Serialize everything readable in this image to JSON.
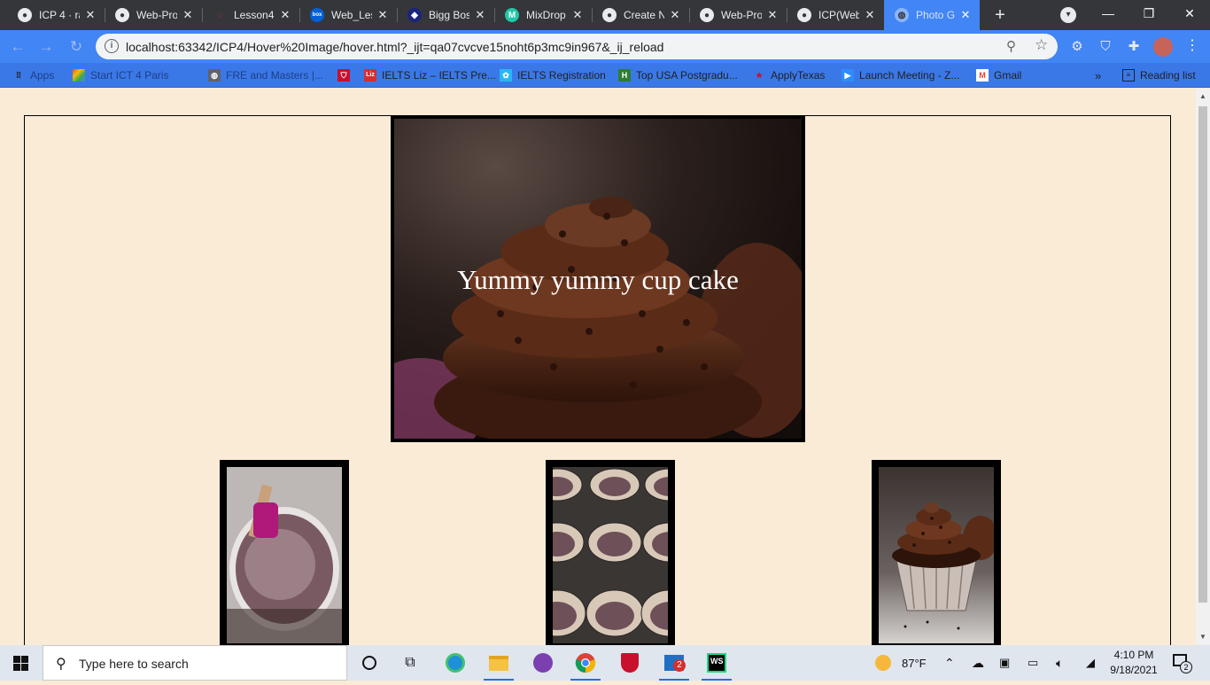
{
  "browser": {
    "tabs": [
      {
        "title": "ICP 4 · ra",
        "icon": "github-icon"
      },
      {
        "title": "Web-Pro",
        "icon": "github-icon"
      },
      {
        "title": "Lesson4",
        "icon": "loading-icon"
      },
      {
        "title": "Web_Les",
        "icon": "box-icon"
      },
      {
        "title": "Bigg Bos",
        "icon": "site-icon"
      },
      {
        "title": "MixDrop",
        "icon": "mixdrop-icon"
      },
      {
        "title": "Create N",
        "icon": "github-icon"
      },
      {
        "title": "Web-Pro",
        "icon": "github-icon"
      },
      {
        "title": "ICP(Web",
        "icon": "github-icon"
      },
      {
        "title": "Photo G",
        "icon": "globe-icon",
        "active": true
      }
    ],
    "url": "localhost:63342/ICP4/Hover%20Image/hover.html?_ijt=qa07cvcve15noht6p3mc9in967&_ij_reload",
    "bookmarks": [
      {
        "label": "Apps",
        "icon": "apps-icon"
      },
      {
        "label": "Start ICT 4 Paris",
        "icon": "colorful-icon"
      },
      {
        "label": "FRE and Masters |...",
        "icon": "globe-icon"
      },
      {
        "label": "",
        "icon": "shield-icon"
      },
      {
        "label": "IELTS Liz – IELTS Pre...",
        "icon": "liz-icon"
      },
      {
        "label": "IELTS Registration",
        "icon": "ielts-icon"
      },
      {
        "label": "Top USA Postgradu...",
        "icon": "h-icon"
      },
      {
        "label": "ApplyTexas",
        "icon": "star-icon"
      },
      {
        "label": "Launch Meeting - Z...",
        "icon": "zoom-icon"
      },
      {
        "label": "Gmail",
        "icon": "gmail-icon"
      }
    ],
    "reading_list": "Reading list"
  },
  "page": {
    "hero_caption": "Yummy yummy cup cake"
  },
  "taskbar": {
    "search_placeholder": "Type here to search",
    "weather": "87°F",
    "time": "4:10 PM",
    "date": "9/18/2021",
    "notification_count": "2",
    "mail_badge": "2"
  },
  "colors": {
    "page_background": "#faebd7",
    "toolbar": "#4285f4",
    "tabstrip": "#35363a"
  }
}
